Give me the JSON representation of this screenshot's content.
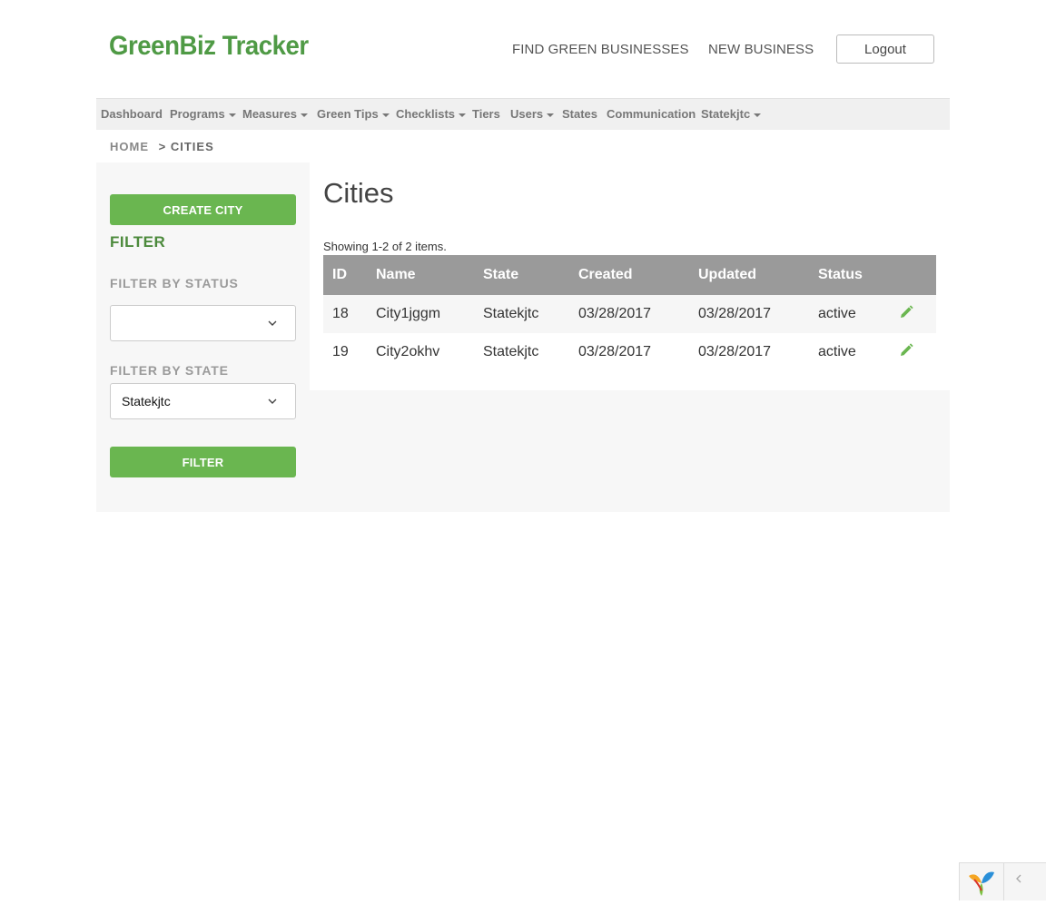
{
  "header": {
    "logo": "GreenBiz Tracker",
    "links": [
      "FIND GREEN BUSINESSES",
      "NEW BUSINESS"
    ],
    "logout": "Logout"
  },
  "nav": {
    "items": [
      {
        "label": "Dashboard",
        "dropdown": false
      },
      {
        "label": "Programs",
        "dropdown": true
      },
      {
        "label": "Measures",
        "dropdown": true
      },
      {
        "label": "Green Tips",
        "dropdown": true
      },
      {
        "label": "Checklists",
        "dropdown": true
      },
      {
        "label": "Tiers",
        "dropdown": false
      },
      {
        "label": "Users",
        "dropdown": true
      },
      {
        "label": "States",
        "dropdown": false
      },
      {
        "label": "Communication",
        "dropdown": false
      },
      {
        "label": "Statekjtc",
        "dropdown": true
      }
    ]
  },
  "breadcrumb": {
    "home": "HOME",
    "separator": ">",
    "current": "CITIES"
  },
  "sidebar": {
    "create_button": "CREATE CITY",
    "filter_title": "FILTER",
    "status_label": "FILTER BY STATUS",
    "status_value": "",
    "state_label": "FILTER BY STATE",
    "state_value": "Statekjtc",
    "filter_button": "FILTER"
  },
  "main": {
    "title": "Cities",
    "summary": "Showing 1-2 of 2 items.",
    "columns": [
      "ID",
      "Name",
      "State",
      "Created",
      "Updated",
      "Status",
      ""
    ],
    "rows": [
      {
        "id": "18",
        "name": "City1jggm",
        "state": "Statekjtc",
        "created": "03/28/2017",
        "updated": "03/28/2017",
        "status": "active"
      },
      {
        "id": "19",
        "name": "City2okhv",
        "state": "Statekjtc",
        "created": "03/28/2017",
        "updated": "03/28/2017",
        "status": "active"
      }
    ]
  },
  "colors": {
    "brand_green": "#4f9a45",
    "button_green": "#6ab650",
    "table_header": "#9a9a9a"
  },
  "icons": {
    "edit": "pencil-icon",
    "select": "chevron-down-icon",
    "debug": "yii-logo-icon",
    "collapse": "chevron-left-icon"
  }
}
